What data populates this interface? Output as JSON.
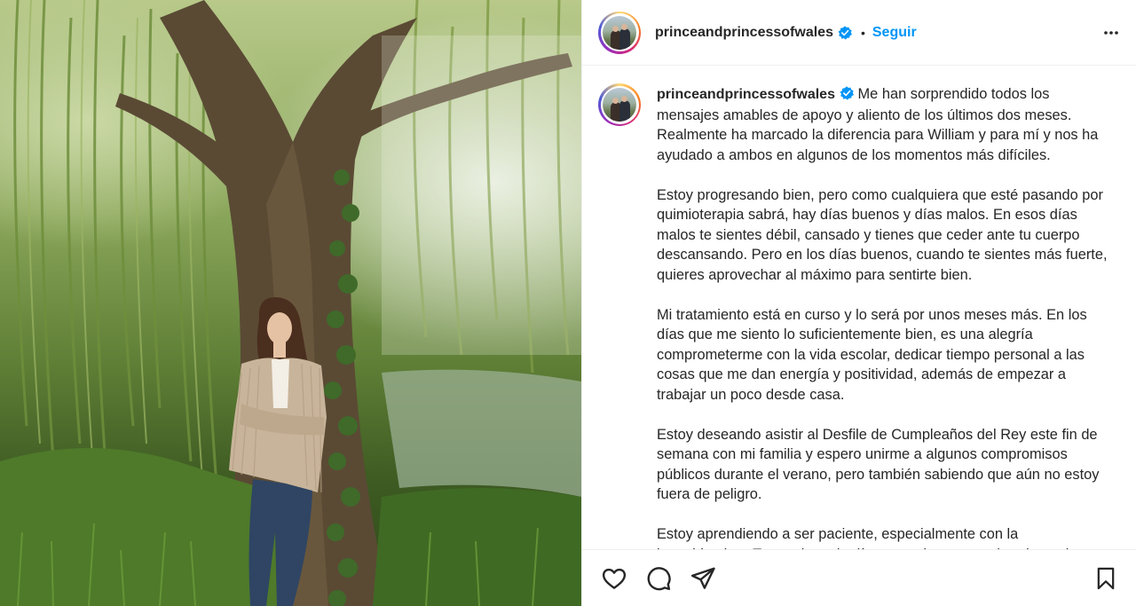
{
  "post": {
    "username": "princeandprincessofwales",
    "separator": "•",
    "follow_label": "Seguir",
    "caption_paragraphs": [
      "Me han sorprendido todos los mensajes amables de apoyo y aliento de los últimos dos meses. Realmente ha marcado la diferencia para William y para mí y nos ha ayudado a ambos en algunos de los momentos más difíciles.",
      "Estoy progresando bien, pero como cualquiera que esté pasando por quimioterapia sabrá, hay días buenos y días malos. En esos días malos te sientes débil, cansado y tienes que ceder ante tu cuerpo descansando. Pero en los días buenos, cuando te sientes más fuerte, quieres aprovechar al máximo para sentirte bien.",
      "Mi tratamiento está en curso y lo será por unos meses más. En los días que me siento lo suficientemente bien, es una alegría comprometerme con la vida escolar, dedicar tiempo personal a las cosas que me dan energía y positividad, además de empezar a trabajar un poco desde casa.",
      "Estoy deseando asistir al Desfile de Cumpleaños del Rey este fin de semana con mi familia y espero unirme a algunos compromisos públicos durante el verano, pero también sabiendo que aún no estoy fuera de peligro.",
      "Estoy aprendiendo a ser paciente, especialmente con la incertidumbre. Tomando cada día como viene, escuchando a mi"
    ]
  },
  "icons": {
    "verified": "verified-badge-icon",
    "more": "more-options-icon",
    "like": "heart-icon",
    "comment": "comment-icon",
    "share": "send-icon",
    "save": "bookmark-icon"
  },
  "colors": {
    "follow": "#0095f6",
    "verified": "#0095f6",
    "text": "#262626",
    "border": "#efefef"
  }
}
